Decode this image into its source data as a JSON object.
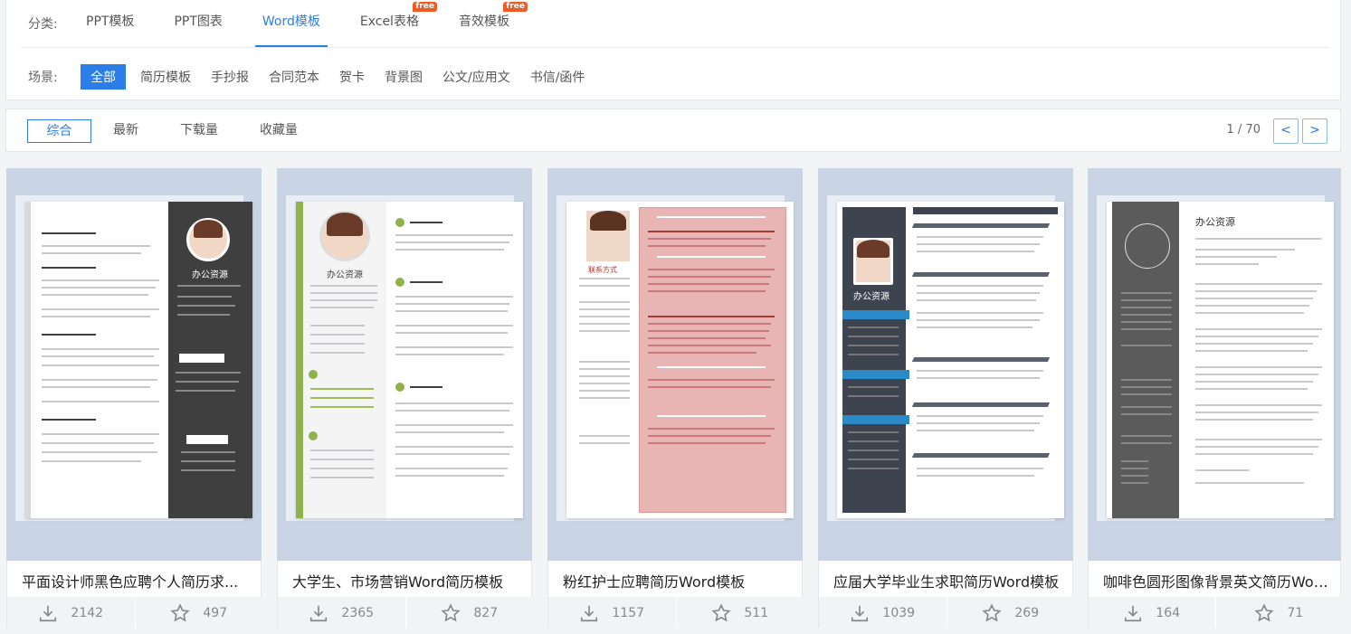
{
  "filters": {
    "category_label": "分类:",
    "categories": [
      {
        "label": "PPT模板",
        "free": false
      },
      {
        "label": "PPT图表",
        "free": false
      },
      {
        "label": "Word模板",
        "free": false
      },
      {
        "label": "Excel表格",
        "free": true
      },
      {
        "label": "音效模板",
        "free": true
      }
    ],
    "free_badge": "free",
    "scene_label": "场景:",
    "scenes": [
      "全部",
      "简历模板",
      "手抄报",
      "合同范本",
      "贺卡",
      "背景图",
      "公文/应用文",
      "书信/函件"
    ]
  },
  "sort": {
    "options": [
      "综合",
      "最新",
      "下载量",
      "收藏量"
    ],
    "page_info": "1 / 70",
    "prev": "<",
    "next": ">"
  },
  "cards": [
    {
      "title": "平面设计师黑色应聘个人简历求...",
      "downloads": "2142",
      "favorites": "497",
      "resume_name": "办公资源"
    },
    {
      "title": "大学生、市场营销Word简历模板",
      "downloads": "2365",
      "favorites": "827",
      "resume_name": "办公资源"
    },
    {
      "title": "粉红护士应聘简历Word模板",
      "downloads": "1157",
      "favorites": "511",
      "resume_name": "联系方式"
    },
    {
      "title": "应届大学毕业生求职简历Word模板",
      "downloads": "1039",
      "favorites": "269",
      "resume_name": "办公资源"
    },
    {
      "title": "咖啡色圆形图像背景英文简历Wor...",
      "downloads": "164",
      "favorites": "71",
      "resume_name": "办公资源"
    }
  ],
  "colors": {
    "accent": "#2b7de9",
    "free_badge": "#f15a24",
    "card_bg": "#c9d5e5"
  }
}
